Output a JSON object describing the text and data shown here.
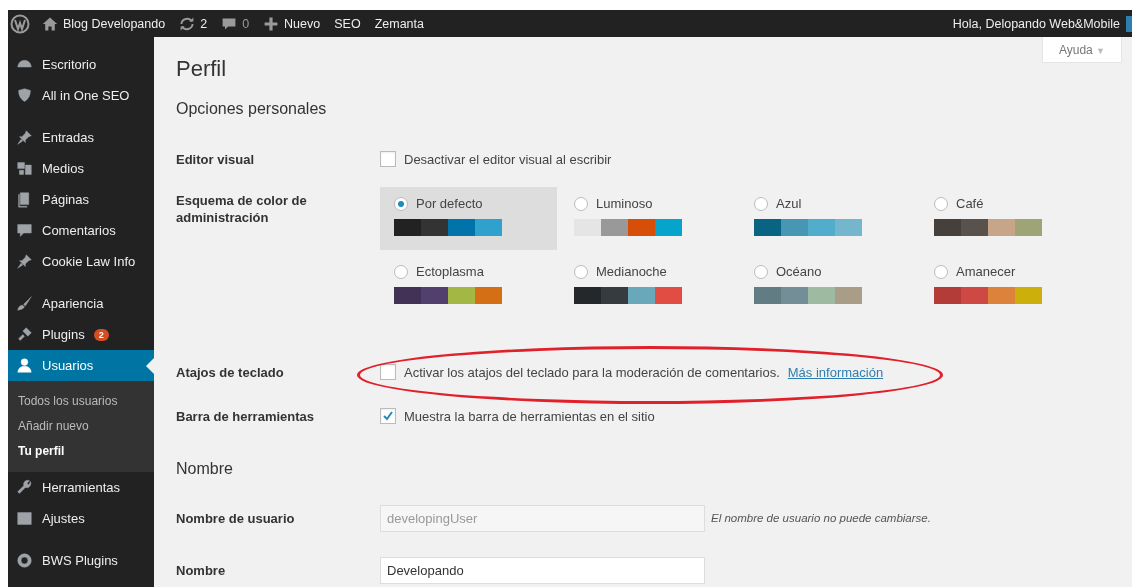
{
  "admin_bar": {
    "site": "Blog Developando",
    "updates": "2",
    "comments": "0",
    "new": "Nuevo",
    "items": [
      "SEO",
      "Zemanta"
    ],
    "greeting": "Hola, Delopando Web&Mobile"
  },
  "help_tab": {
    "label": "Ayuda",
    "caret": "▼"
  },
  "sidebar": {
    "groups": [
      {
        "items": [
          {
            "label": "Escritorio",
            "selected": false
          },
          {
            "label": "All in One SEO",
            "selected": false
          }
        ]
      },
      {
        "items": [
          {
            "label": "Entradas",
            "selected": false
          },
          {
            "label": "Medios",
            "selected": false
          },
          {
            "label": "Páginas",
            "selected": false
          },
          {
            "label": "Comentarios",
            "selected": false
          },
          {
            "label": "Cookie Law Info",
            "selected": false
          }
        ]
      },
      {
        "items": [
          {
            "label": "Apariencia",
            "selected": false
          },
          {
            "label": "Plugins",
            "selected": false,
            "badge": "2"
          },
          {
            "label": "Usuarios",
            "selected": true,
            "children": [
              {
                "label": "Todos los usuarios",
                "selected": false
              },
              {
                "label": "Añadir nuevo",
                "selected": false
              },
              {
                "label": "Tu perfil",
                "selected": true
              }
            ]
          },
          {
            "label": "Herramientas",
            "selected": false
          },
          {
            "label": "Ajustes",
            "selected": false
          }
        ]
      },
      {
        "items": [
          {
            "label": "BWS Plugins",
            "selected": false
          }
        ]
      }
    ]
  },
  "page": {
    "title": "Perfil",
    "section_personal": "Opciones personales",
    "visual_editor": {
      "label": "Editor visual",
      "option": "Desactivar el editor visual al escribir",
      "checked": false
    },
    "color_scheme": {
      "label": "Esquema de color de administración",
      "schemes": [
        {
          "name": "Por defecto",
          "selected": true,
          "swatches": [
            {
              "color": "#222222"
            },
            {
              "color": "#333333"
            },
            {
              "color": "#0073aa"
            },
            {
              "color": "#2ea2cc"
            }
          ]
        },
        {
          "name": "Luminoso",
          "selected": false,
          "swatches": [
            {
              "color": "#e5e5e5"
            },
            {
              "color": "#999999"
            },
            {
              "color": "#d64e07"
            },
            {
              "color": "#04a4cc"
            }
          ]
        },
        {
          "name": "Azul",
          "selected": false,
          "swatches": [
            {
              "color": "#096484"
            },
            {
              "color": "#4796b3"
            },
            {
              "color": "#52accc"
            },
            {
              "color": "#74b6ce"
            }
          ]
        },
        {
          "name": "Café",
          "selected": false,
          "swatches": [
            {
              "color": "#46403c"
            },
            {
              "color": "#59524c"
            },
            {
              "color": "#c7a589"
            },
            {
              "color": "#9ea476"
            }
          ]
        },
        {
          "name": "Ectoplasma",
          "selected": false,
          "swatches": [
            {
              "color": "#413256"
            },
            {
              "color": "#523f6d"
            },
            {
              "color": "#a3b745"
            },
            {
              "color": "#d46f15"
            }
          ]
        },
        {
          "name": "Medianoche",
          "selected": false,
          "swatches": [
            {
              "color": "#25282b"
            },
            {
              "color": "#363b3f"
            },
            {
              "color": "#69a8bb"
            },
            {
              "color": "#e14d43"
            }
          ]
        },
        {
          "name": "Océano",
          "selected": false,
          "swatches": [
            {
              "color": "#627c83"
            },
            {
              "color": "#738e96"
            },
            {
              "color": "#9ebaa0"
            },
            {
              "color": "#aa9d88"
            }
          ]
        },
        {
          "name": "Amanecer",
          "selected": false,
          "swatches": [
            {
              "color": "#b43c38"
            },
            {
              "color": "#cf4944"
            },
            {
              "color": "#dd823b"
            },
            {
              "color": "#ccaf0b"
            }
          ]
        }
      ]
    },
    "shortcuts": {
      "label": "Atajos de teclado",
      "option": "Activar los atajos del teclado para la moderación de comentarios.",
      "link": "Más información",
      "checked": false,
      "circled": true
    },
    "toolbar": {
      "label": "Barra de herramientas",
      "option": "Muestra la barra de herramientas en el sitio",
      "checked": true
    },
    "section_name": "Nombre",
    "username": {
      "label": "Nombre de usuario",
      "value": "developingUser",
      "disabled": true,
      "note": "El nombre de usuario no puede cambiarse."
    },
    "first_name": {
      "label": "Nombre",
      "value": "Developando"
    }
  }
}
